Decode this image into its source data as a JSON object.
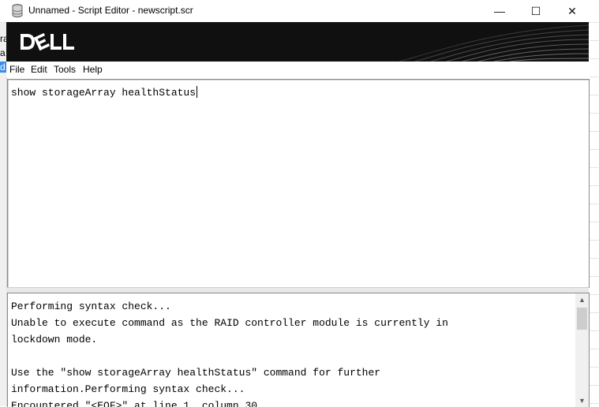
{
  "window": {
    "title": "Unnamed - Script Editor - newscript.scr",
    "minimize_glyph": "—",
    "maximize_glyph": "☐",
    "close_glyph": "✕"
  },
  "background": {
    "left_fragments": [
      "ra",
      "a",
      "d"
    ]
  },
  "banner": {
    "brand_color": "#101010"
  },
  "menu": {
    "items": [
      "File",
      "Edit",
      "Tools",
      "Help"
    ]
  },
  "editor": {
    "content": "show storageArray healthStatus"
  },
  "output": {
    "lines": [
      "Performing syntax check...",
      "Unable to execute command as the RAID controller module is currently in",
      "lockdown mode.",
      "",
      "Use the \"show storageArray healthStatus\" command for further",
      "information.Performing syntax check...",
      "Encountered \"<EOF>\" at line 1, column 30."
    ]
  },
  "scrollbar": {
    "up_glyph": "▲",
    "down_glyph": "▼"
  }
}
